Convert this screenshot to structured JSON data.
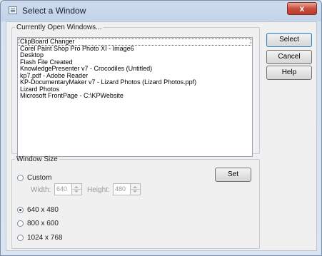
{
  "window": {
    "title": "Select a Window",
    "close_label": "x"
  },
  "open_windows": {
    "legend": "Currently Open Windows...",
    "items": [
      "ClipBoard Changer",
      "Corel Paint Shop Pro Photo XI - Image6",
      "Desktop",
      "Flash File Created",
      "KnowledgePresenter v7 - Crocodiles (Untitled)",
      "kp7.pdf - Adobe Reader",
      "KP-DocumentaryMaker v7 - Lizard Photos (Lizard Photos.ppf)",
      "Lizard Photos",
      "Microsoft FrontPage - C:\\KPWebsite"
    ],
    "focused_index": 0
  },
  "buttons": {
    "select": "Select",
    "cancel": "Cancel",
    "help": "Help",
    "set": "Set"
  },
  "window_size": {
    "legend": "Window Size",
    "custom_label": "Custom",
    "width_label": "Width:",
    "width_value": "640",
    "height_label": "Height:",
    "height_value": "480",
    "options": [
      "640 x 480",
      "800 x 600",
      "1024 x 768"
    ],
    "selected": "640 x 480"
  }
}
